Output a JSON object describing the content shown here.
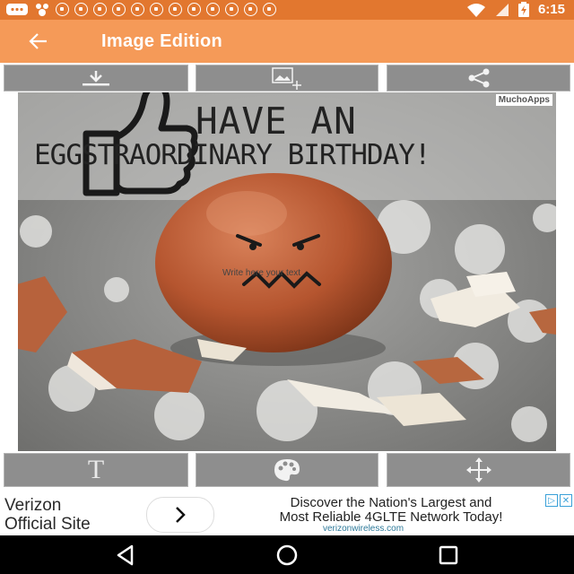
{
  "status_bar": {
    "time": "6:15"
  },
  "app_bar": {
    "title": "Image Edition",
    "back_icon": "arrow-left-icon"
  },
  "top_toolbar": [
    {
      "name": "download-button",
      "icon": "download-icon"
    },
    {
      "name": "add-image-button",
      "icon": "add-image-icon"
    },
    {
      "name": "share-button",
      "icon": "share-icon"
    }
  ],
  "canvas": {
    "watermark": "MuchoApps",
    "line1": "HAVE AN",
    "line2": "EGGSTRAORDINARY BIRTHDAY!",
    "text_placeholder": "Write here your text",
    "sticker_icon": "thumbs-up-icon"
  },
  "bottom_toolbar": [
    {
      "name": "text-tool-button",
      "icon": "text-icon",
      "label": "T"
    },
    {
      "name": "color-palette-button",
      "icon": "palette-icon"
    },
    {
      "name": "move-tool-button",
      "icon": "move-arrows-icon"
    }
  ],
  "ad": {
    "brand_line1": "Verizon",
    "brand_line2": "Official Site",
    "headline_line1": "Discover the Nation's Largest and",
    "headline_line2": "Most Reliable 4GLTE Network Today!",
    "url": "verizonwireless.com",
    "go_icon": "chevron-right-icon"
  },
  "colors": {
    "status_bar": "#e2772f",
    "app_bar": "#f59a58",
    "toolbar_button": "#8e8e8e",
    "egg": "#b5552f"
  }
}
